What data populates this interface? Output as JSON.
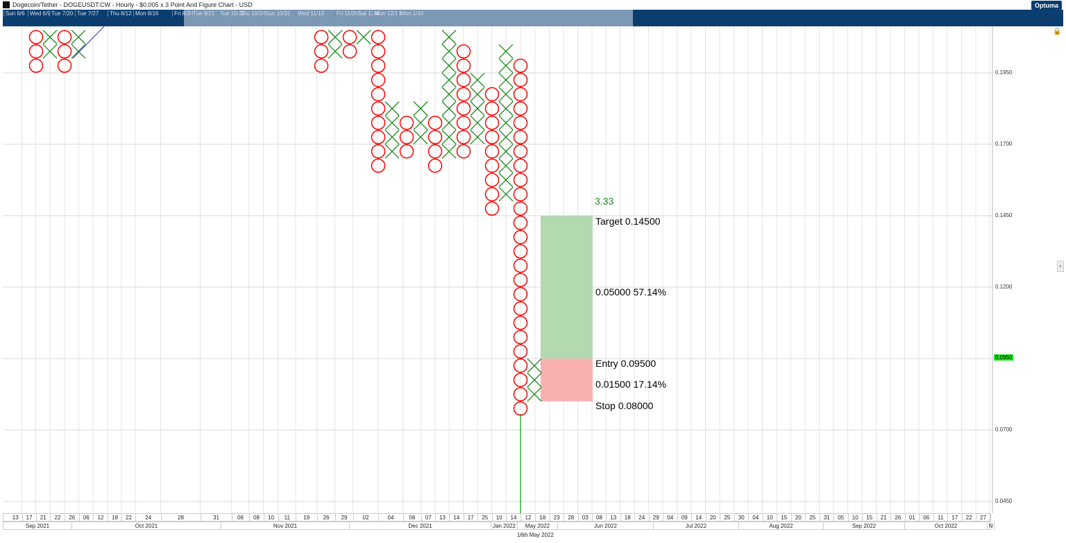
{
  "header": {
    "title": "Dogecoin/Tether - DOGEUSDT:CW - Hourly - $0.005 x 3 Point And Figure Chart - USD",
    "logo": "Optuma",
    "navigator_labels": [
      "Sun 6/6",
      "Wed 6/9",
      "Tue 7/20",
      "Tue 7/27",
      "Thu 8/12",
      "Mon 8/16",
      "Fri 8/20",
      "Tue 9/21",
      "Tue 10/12",
      "Thu 10/28",
      "Sun 10/31",
      "Wed 11/10",
      "Fri 11/26",
      "Sat 12/4",
      "Mon 12/13",
      "Mon 1/10"
    ]
  },
  "footer": {
    "cursor_date": "16th May 2022"
  },
  "colors": {
    "x": "#1a8a1a",
    "o": "#ff0000",
    "target": "#b3d9b0",
    "stop": "#f9b0b0",
    "current": "#1ee61e"
  },
  "chart_data": {
    "type": "point-and-figure",
    "box_size": 0.005,
    "reversal": 3,
    "y_ticks": [
      "0.1950",
      "0.1700",
      "0.1450",
      "0.1200",
      "0.0950",
      "0.0700",
      "0.0450"
    ],
    "current_price": "0.0950",
    "columns": [
      {
        "t": "O",
        "from": 0.205,
        "to": 0.195
      },
      {
        "t": "X",
        "from": 0.2,
        "to": 0.205
      },
      {
        "t": "O",
        "from": 0.205,
        "to": 0.195
      },
      {
        "t": "X",
        "from": 0.2,
        "to": 0.205
      },
      {
        "t": "O",
        "from": 0.205,
        "to": 0.195
      },
      {
        "t": "X",
        "from": 0.2,
        "to": 0.205
      },
      {
        "t": "O",
        "from": 0.205,
        "to": 0.2
      },
      {
        "t": "X",
        "from": 0.205,
        "to": 0.205
      },
      {
        "t": "O",
        "from": 0.205,
        "to": 0.16
      },
      {
        "t": "X",
        "from": 0.165,
        "to": 0.18
      },
      {
        "t": "O",
        "from": 0.175,
        "to": 0.165
      },
      {
        "t": "X",
        "from": 0.17,
        "to": 0.18
      },
      {
        "t": "O",
        "from": 0.175,
        "to": 0.16
      },
      {
        "t": "X",
        "from": 0.165,
        "to": 0.205
      },
      {
        "t": "O",
        "from": 0.2,
        "to": 0.165
      },
      {
        "t": "X",
        "from": 0.17,
        "to": 0.19
      },
      {
        "t": "O",
        "from": 0.185,
        "to": 0.145
      },
      {
        "t": "X",
        "from": 0.15,
        "to": 0.2
      },
      {
        "t": "O",
        "from": 0.195,
        "to": 0.075
      },
      {
        "t": "X",
        "from": 0.08,
        "to": 0.09
      }
    ],
    "trade": {
      "ratio": "3.33",
      "target": "Target  0.14500",
      "reward": "0.05000  57.14%",
      "entry": "Entry  0.09500",
      "risk": "0.01500  17.14%",
      "stop": "Stop  0.08000"
    },
    "x_ticks": [
      "13",
      "17",
      "21",
      "22",
      "26",
      "06",
      "12",
      "18",
      "22",
      "24",
      "28",
      "31",
      "06",
      "08",
      "10",
      "11",
      "19",
      "26",
      "29",
      "02",
      "04",
      "06",
      "07",
      "13",
      "14",
      "17",
      "25",
      "10",
      "14",
      "12",
      "18",
      "23",
      "28",
      "03",
      "08",
      "13",
      "18",
      "24",
      "29",
      "04",
      "09",
      "14",
      "20",
      "25",
      "30",
      "04",
      "10",
      "15",
      "20",
      "25",
      "31",
      "05",
      "10",
      "15",
      "21",
      "26",
      "01",
      "06",
      "11",
      "17",
      "22",
      "27"
    ],
    "months": [
      "Sep 2021",
      "Oct 2021",
      "Nov 2021",
      "Dec 2021",
      "Jan 2022",
      "May 2022",
      "Jun 2022",
      "Jul 2022",
      "Aug 2022",
      "Sep 2022",
      "Oct 2022",
      "N"
    ]
  }
}
